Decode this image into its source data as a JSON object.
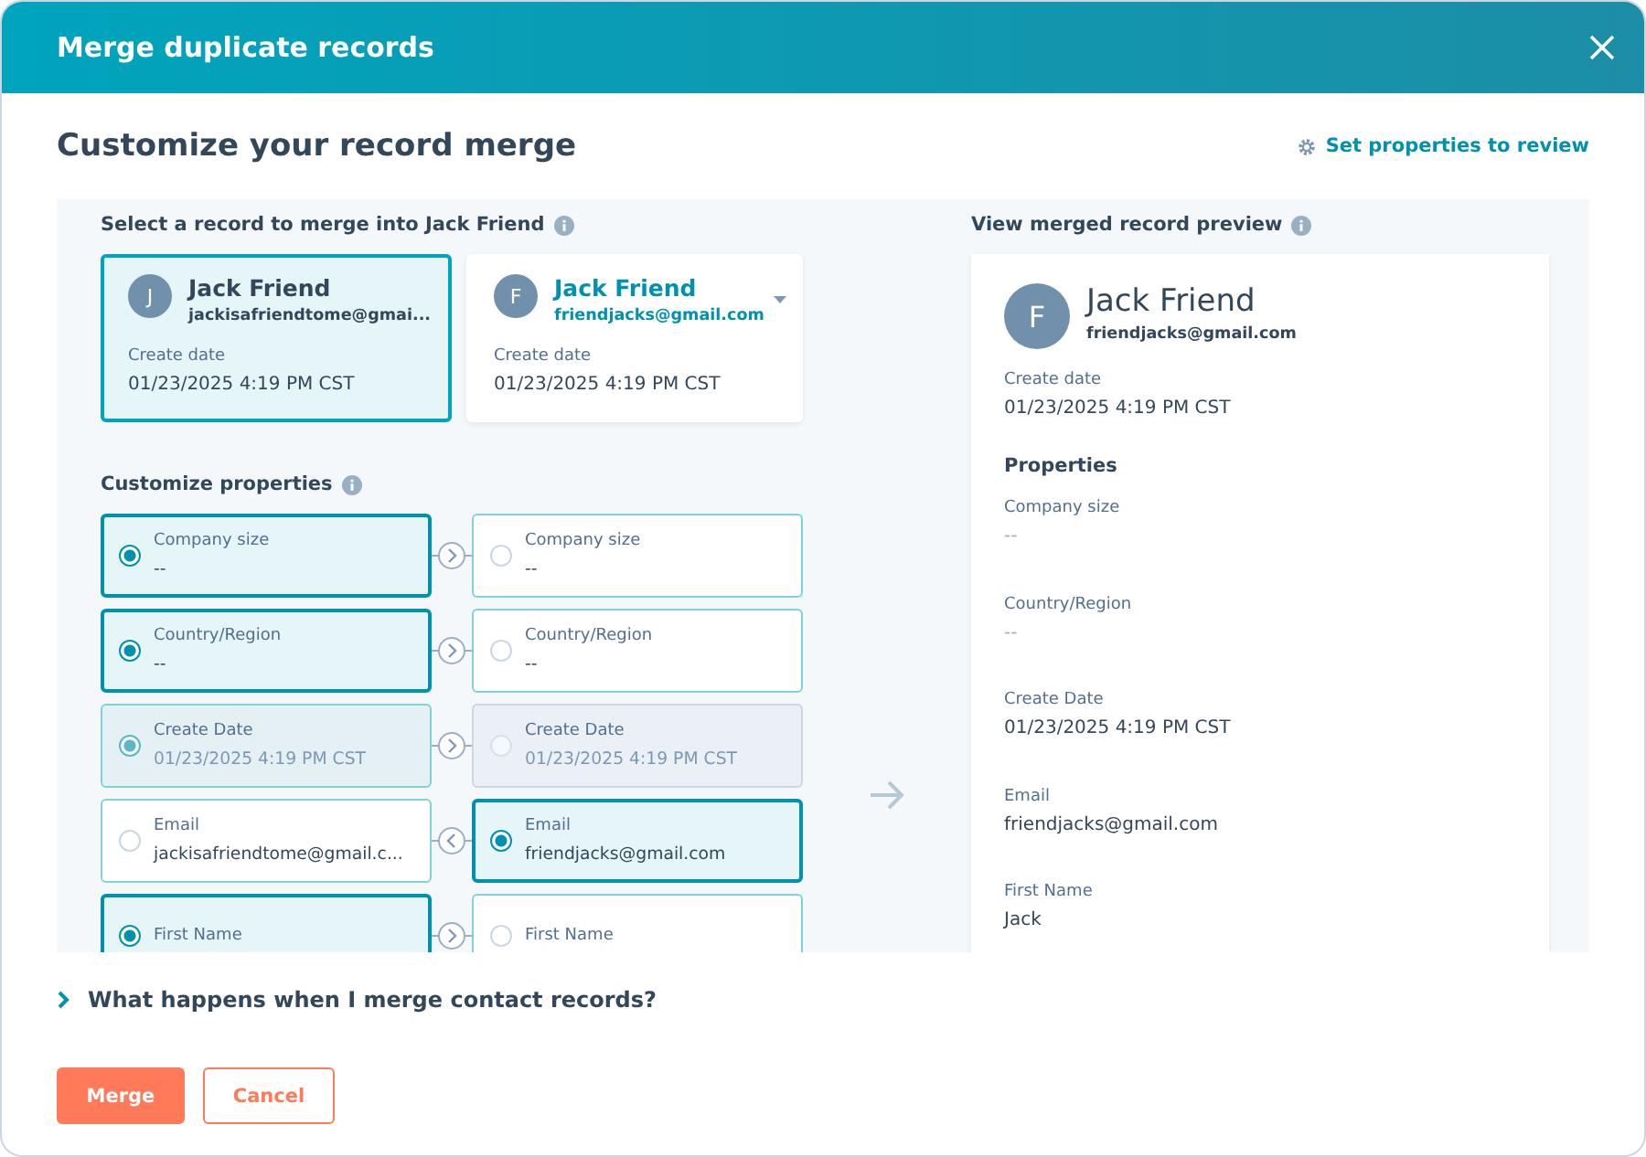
{
  "dialog": {
    "title": "Merge duplicate records"
  },
  "heading": "Customize your record merge",
  "review_link": "Set properties to review",
  "select_section": {
    "title": "Select a record to merge into Jack Friend",
    "records": [
      {
        "initial": "J",
        "name": "Jack Friend",
        "email": "jackisafriendtome@gmai...",
        "date_label": "Create date",
        "date_value": "01/23/2025 4:19 PM CST",
        "selected": true,
        "dropdown": false
      },
      {
        "initial": "F",
        "name": "Jack Friend",
        "email": "friendjacks@gmail.com",
        "date_label": "Create date",
        "date_value": "01/23/2025 4:19 PM CST",
        "selected": false,
        "dropdown": true
      }
    ]
  },
  "properties_section": {
    "title": "Customize properties",
    "rows": [
      {
        "disabled": false,
        "left": {
          "label": "Company size",
          "value": "--",
          "selected": true
        },
        "right": {
          "label": "Company size",
          "value": "--",
          "selected": false
        }
      },
      {
        "disabled": false,
        "left": {
          "label": "Country/Region",
          "value": "--",
          "selected": true
        },
        "right": {
          "label": "Country/Region",
          "value": "--",
          "selected": false
        }
      },
      {
        "disabled": true,
        "left": {
          "label": "Create Date",
          "value": "01/23/2025 4:19 PM CST",
          "selected": true
        },
        "right": {
          "label": "Create Date",
          "value": "01/23/2025 4:19 PM CST",
          "selected": false
        }
      },
      {
        "disabled": false,
        "left": {
          "label": "Email",
          "value": "jackisafriendtome@gmail.c...",
          "selected": false
        },
        "right": {
          "label": "Email",
          "value": "friendjacks@gmail.com",
          "selected": true
        }
      },
      {
        "disabled": false,
        "left": {
          "label": "First Name",
          "selected": true
        },
        "right": {
          "label": "First Name",
          "selected": false
        }
      }
    ]
  },
  "preview": {
    "title": "View merged record preview",
    "initial": "F",
    "name": "Jack Friend",
    "email": "friendjacks@gmail.com",
    "date_label": "Create date",
    "date_value": "01/23/2025 4:19 PM CST",
    "properties_title": "Properties",
    "items": [
      {
        "label": "Company size",
        "value": "--",
        "empty": true
      },
      {
        "label": "Country/Region",
        "value": "--",
        "empty": true
      },
      {
        "label": "Create Date",
        "value": "01/23/2025 4:19 PM CST",
        "empty": false
      },
      {
        "label": "Email",
        "value": "friendjacks@gmail.com",
        "empty": false
      },
      {
        "label": "First Name",
        "value": "Jack",
        "empty": false
      }
    ]
  },
  "faq": {
    "label": "What happens when I merge contact records?",
    "expanded": false
  },
  "buttons": [
    {
      "label": "Merge",
      "kind": "primary"
    },
    {
      "label": "Cancel",
      "kind": "secondary"
    }
  ]
}
